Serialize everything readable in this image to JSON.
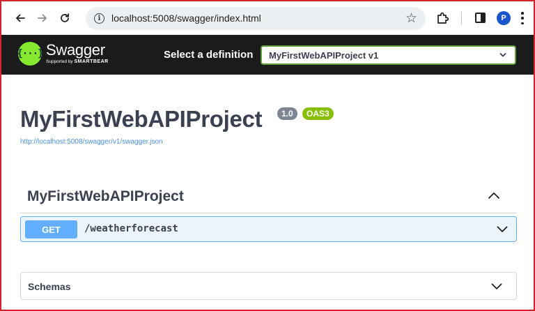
{
  "browser": {
    "url": "localhost:5008/swagger/index.html",
    "info_icon_glyph": "i",
    "profile_initial": "P",
    "accent": "#1a56c9"
  },
  "swagger_bar": {
    "logo_glyph": "{···}",
    "logo_title": "Swagger",
    "logo_sub_prefix": "Supported by",
    "logo_sub_brand": "SMARTBEAR",
    "definition_label": "Select a definition",
    "definition_selected": "MyFirstWebAPIProject v1",
    "brand_green": "#85ea2d"
  },
  "info": {
    "title": "MyFirstWebAPIProject",
    "version_badge": "1.0",
    "oas_badge": "OAS3",
    "spec_url": "http://localhost:5008/swagger/v1/swagger.json"
  },
  "tag": {
    "name": "MyFirstWebAPIProject",
    "operations": [
      {
        "method": "GET",
        "path": "/weatherforecast",
        "color": "#61affe"
      }
    ]
  },
  "schemas": {
    "title": "Schemas"
  }
}
